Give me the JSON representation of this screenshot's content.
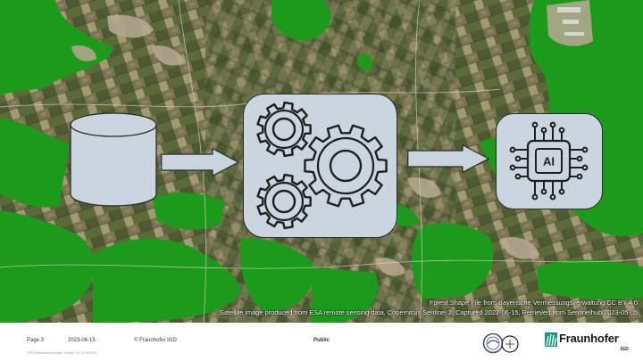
{
  "credits": {
    "line1": "Forest Shape File from Bayerische Vermessungsverwaltung CC BY 4.0",
    "line2": "Satellite image produced from ESA remote sensing data, Copernicus Sentinel 2, Captured 2022-06-15, Retrieved from Sentinelhub 2023-05-05"
  },
  "diagram": {
    "nodes": [
      {
        "id": "database",
        "icon": "database-cylinder-icon"
      },
      {
        "id": "processing",
        "icon": "gears-icon"
      },
      {
        "id": "ai",
        "icon": "ai-chip-icon",
        "label": "AI"
      }
    ],
    "edges": [
      {
        "from": "database",
        "to": "processing"
      },
      {
        "from": "processing",
        "to": "ai"
      }
    ]
  },
  "footer": {
    "page": "Page 3",
    "date": "2023-06-15",
    "copyright": "© Fraunhofer IGD",
    "classification": "Public",
    "small_print": "FHG-Präsentationsvorlage, Version 1.6, 12.06.2023",
    "brand": "Fraunhofer",
    "brand_sub": "IGD"
  },
  "colors": {
    "forest": "#1c9a1c",
    "node_fill": "#cad5df",
    "node_stroke": "#2b2b2b",
    "arrow_fill": "#c9d4de"
  }
}
